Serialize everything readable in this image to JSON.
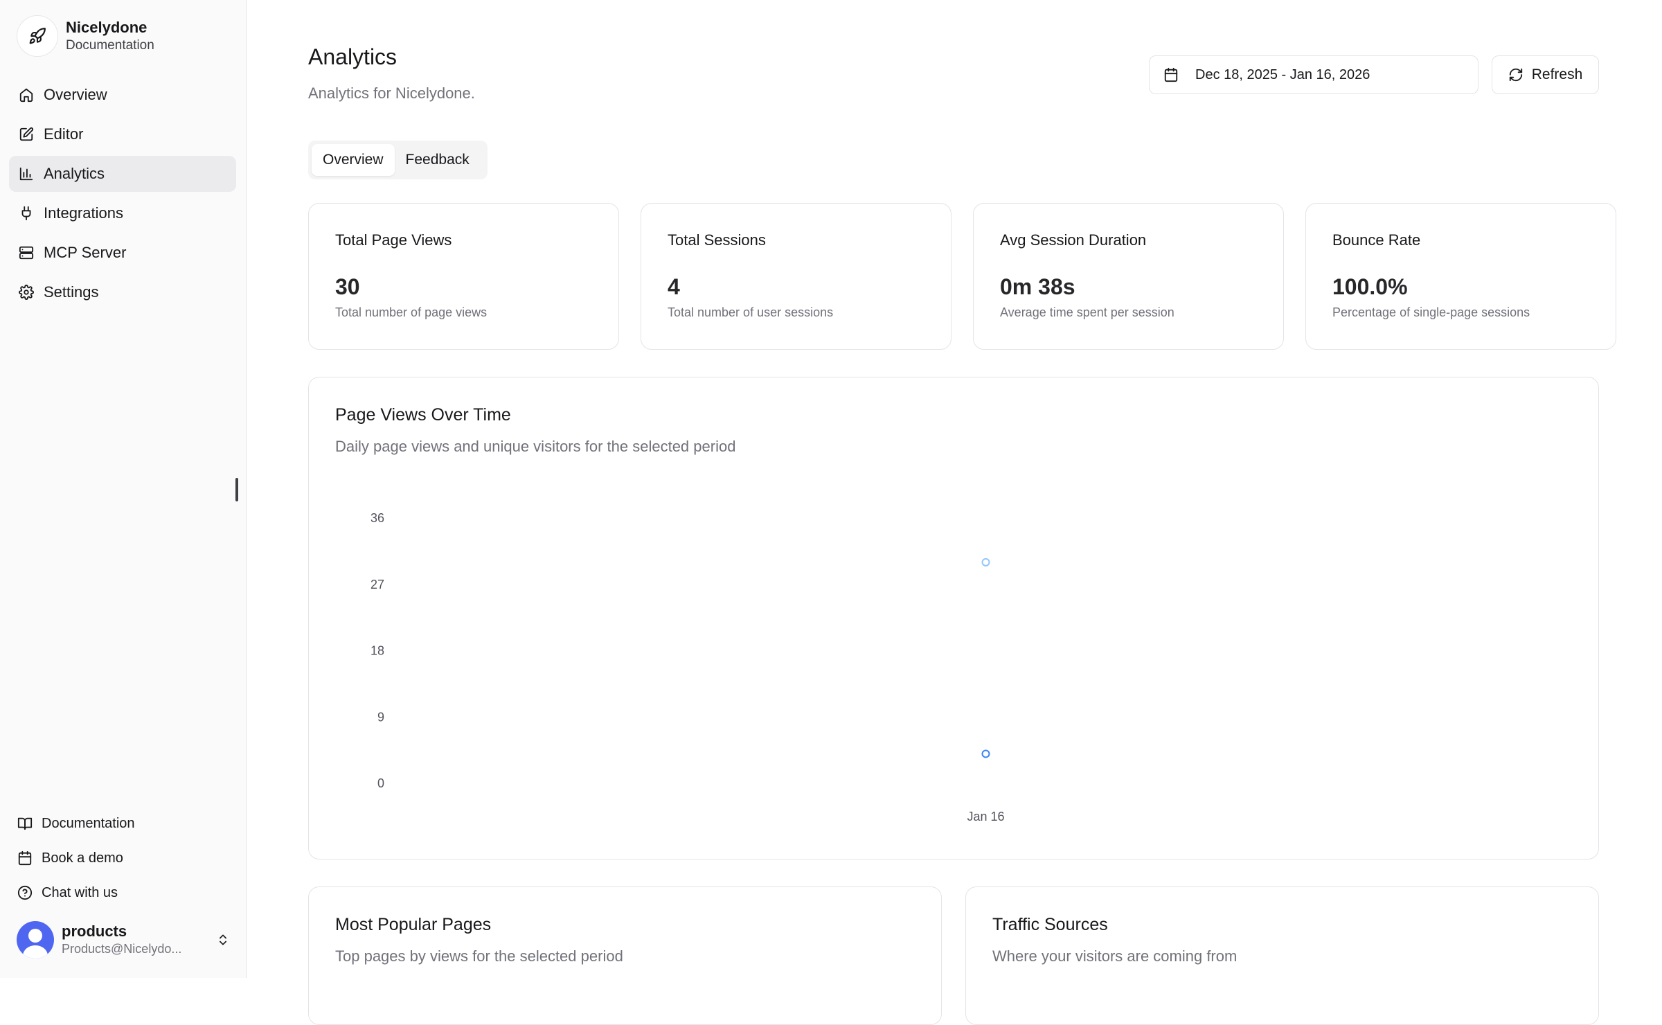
{
  "brand": {
    "name": "Nicelydone",
    "subtitle": "Documentation"
  },
  "nav": {
    "items": [
      {
        "label": "Overview",
        "icon": "home-icon"
      },
      {
        "label": "Editor",
        "icon": "edit-icon"
      },
      {
        "label": "Analytics",
        "icon": "bar-chart-icon",
        "active": true
      },
      {
        "label": "Integrations",
        "icon": "plug-icon"
      },
      {
        "label": "MCP Server",
        "icon": "server-icon"
      },
      {
        "label": "Settings",
        "icon": "gear-icon"
      }
    ]
  },
  "footer_links": [
    {
      "label": "Documentation",
      "icon": "book-icon"
    },
    {
      "label": "Book a demo",
      "icon": "calendar-icon"
    },
    {
      "label": "Chat with us",
      "icon": "help-circle-icon"
    }
  ],
  "user": {
    "name": "products",
    "email": "Products@Nicelydo..."
  },
  "header": {
    "title": "Analytics",
    "subtitle": "Analytics for Nicelydone.",
    "date_range": "Dec 18, 2025 - Jan 16, 2026",
    "refresh_label": "Refresh"
  },
  "tabs": [
    {
      "label": "Overview",
      "active": true
    },
    {
      "label": "Feedback",
      "active": false
    }
  ],
  "stats": [
    {
      "title": "Total Page Views",
      "value": "30",
      "desc": "Total number of page views"
    },
    {
      "title": "Total Sessions",
      "value": "4",
      "desc": "Total number of user sessions"
    },
    {
      "title": "Avg Session Duration",
      "value": "0m 38s",
      "desc": "Average time spent per session"
    },
    {
      "title": "Bounce Rate",
      "value": "100.0%",
      "desc": "Percentage of single-page sessions"
    }
  ],
  "chart": {
    "title": "Page Views Over Time",
    "subtitle": "Daily page views and unique visitors for the selected period"
  },
  "chart_data": {
    "type": "line",
    "x": [
      "Jan 16"
    ],
    "yticks": [
      0,
      9,
      18,
      27,
      36
    ],
    "ylim": [
      0,
      36
    ],
    "series": [
      {
        "values": [
          30
        ],
        "color": "#93c5fd"
      },
      {
        "values": [
          4
        ],
        "color": "#3b82f6"
      }
    ],
    "grid": false,
    "legend": "none"
  },
  "bottom_cards": [
    {
      "title": "Most Popular Pages",
      "subtitle": "Top pages by views for the selected period"
    },
    {
      "title": "Traffic Sources",
      "subtitle": "Where your visitors are coming from"
    }
  ],
  "colors": {
    "accent": "#4f66f0",
    "active_nav": "#ebebed",
    "muted_text": "#71717a"
  }
}
